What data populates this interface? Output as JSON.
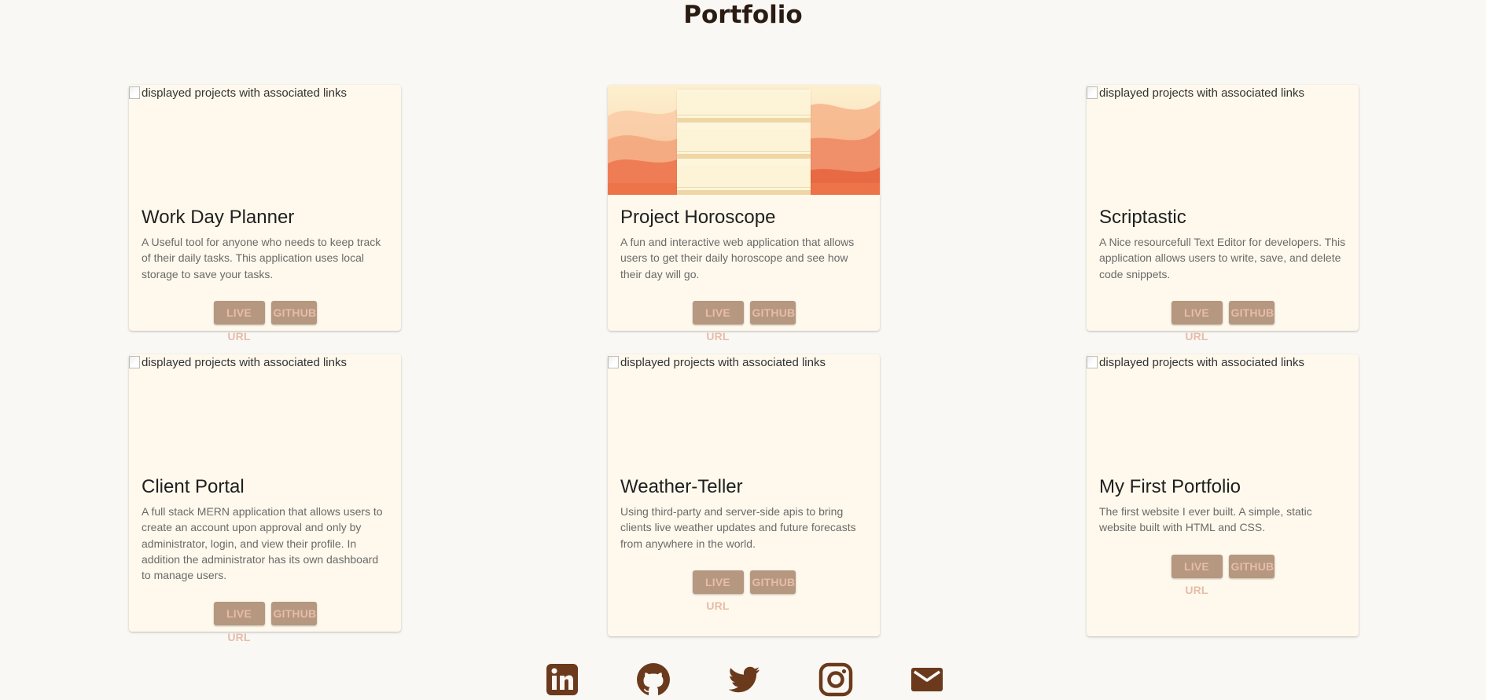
{
  "page": {
    "title": "Portfolio",
    "image_alt": "displayed projects with associated links"
  },
  "colors": {
    "background": "#faf8f5",
    "card": "#fef9ec",
    "button_bg": "#b69780",
    "button_text": "#e6bcaa",
    "icon": "#6b3a1c"
  },
  "projects": [
    {
      "title": "Work Day Planner",
      "description": "A Useful tool for anyone who needs to keep track of their daily tasks. This application uses local storage to save your tasks.",
      "live_label": "LIVE URL",
      "github_label": "GITHUB",
      "image": "broken"
    },
    {
      "title": "Project Horoscope",
      "description": "A fun and interactive web application that allows users to get their daily horoscope and see how their day will go.",
      "live_label": "LIVE URL",
      "github_label": "GITHUB",
      "image": "horoscope-screenshot"
    },
    {
      "title": "Scriptastic",
      "description": "A Nice resourcefull Text Editor for developers. This application allows users to write, save, and delete code snippets.",
      "live_label": "LIVE URL",
      "github_label": "GITHUB",
      "image": "broken"
    },
    {
      "title": "Client Portal",
      "description": "A full stack MERN application that allows users to create an account upon approval and only by administrator, login, and view their profile. In addition the administrator has its own dashboard to manage users.",
      "live_label": "LIVE URL",
      "github_label": "GITHUB",
      "image": "broken"
    },
    {
      "title": "Weather-Teller",
      "description": "Using third-party and server-side apis to bring clients live weather updates and future forecasts from anywhere in the world.",
      "live_label": "LIVE URL",
      "github_label": "GITHUB",
      "image": "broken"
    },
    {
      "title": "My First Portfolio",
      "description": "The first website I ever built. A simple, static website built with HTML and CSS.",
      "live_label": "LIVE URL",
      "github_label": "GITHUB",
      "image": "broken"
    }
  ],
  "social": [
    {
      "icon": "linkedin-icon"
    },
    {
      "icon": "github-icon"
    },
    {
      "icon": "twitter-icon"
    },
    {
      "icon": "instagram-icon"
    },
    {
      "icon": "email-icon"
    }
  ]
}
